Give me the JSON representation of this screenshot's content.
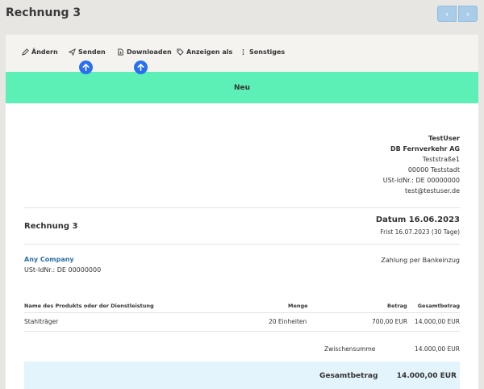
{
  "page": {
    "title": "Rechnung 3"
  },
  "pager": {
    "prev": "‹",
    "next": "›"
  },
  "toolbar": {
    "edit": "Ändern",
    "send": "Senden",
    "download": "Downloaden",
    "show_as": "Anzeigen als",
    "more": "Sonstiges"
  },
  "status": {
    "label": "Neu",
    "color": "#5cf0b6"
  },
  "sender": {
    "name": "TestUser",
    "company": "DB Fernverkehr AG",
    "street": "Teststraße1",
    "city": "00000 Teststadt",
    "vat": "USt-IdNr.: DE 00000000",
    "email": "test@testuser.de"
  },
  "invoice": {
    "title": "Rechnung 3",
    "date": "Datum 16.06.2023",
    "due": "Frist 16.07.2023 (30 Tage)"
  },
  "customer": {
    "name": "Any Company",
    "vat": "USt-IdNr.: DE 00000000"
  },
  "payment": {
    "method": "Zahlung per Bankeinzug"
  },
  "table": {
    "headers": {
      "product": "Name des Produkts oder der Dienstleistung",
      "qty": "Menge",
      "price": "Betrag",
      "total": "Gesamtbetrag"
    },
    "rows": [
      {
        "product": "Stahlträger",
        "qty": "20 Einheiten",
        "price": "700,00 EUR",
        "total": "14.000,00 EUR"
      }
    ]
  },
  "summary": {
    "subtotal_label": "Zwischensumme",
    "subtotal_value": "14.000,00 EUR",
    "total_label": "Gesamtbetrag",
    "total_value": "14.000,00 EUR"
  },
  "colors": {
    "accent": "#2a6ff0",
    "link": "#2a6ea6",
    "total_bg": "#e4f4fd"
  }
}
